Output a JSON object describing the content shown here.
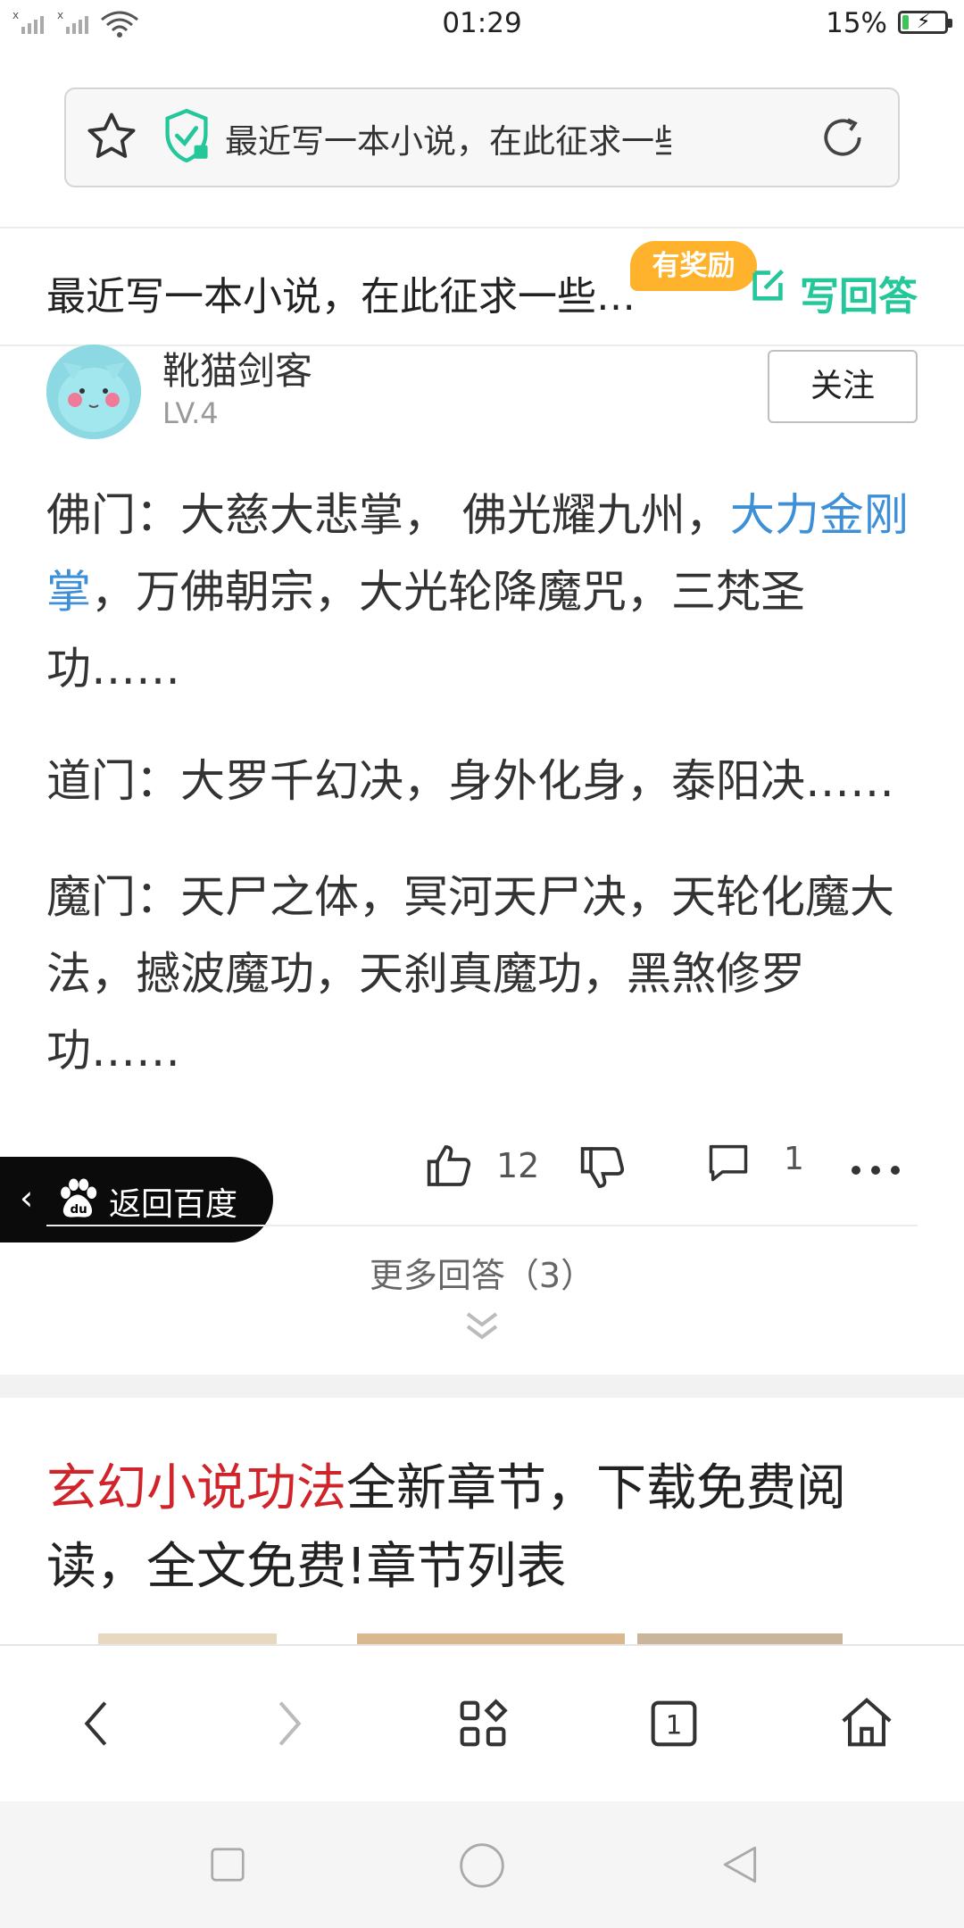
{
  "status_bar": {
    "time": "01:29",
    "battery_percent": "15%",
    "battery_level": 0.15,
    "icons": [
      "signal-icon",
      "signal-icon",
      "wifi-icon",
      "battery-charging-icon"
    ]
  },
  "address_bar": {
    "url_text": "最近写一本小说，在此征求一些…",
    "icons": [
      "star-icon",
      "shield-check-icon",
      "refresh-icon"
    ]
  },
  "question": {
    "title": "最近写一本小说，在此征求一些…",
    "reward_badge": "有奖励",
    "write_answer": "写回答"
  },
  "answer": {
    "user": {
      "name": "靴猫剑客",
      "level": "LV.4"
    },
    "follow_label": "关注",
    "paragraphs": {
      "p1_a": "佛门：大慈大悲掌， 佛光耀九州，",
      "p1_link": "大力金刚掌",
      "p1_b": "，万佛朝宗，大光轮降魔咒，三梵圣功……",
      "p2": "道门：大罗千幻决，身外化身，泰阳决……",
      "p3": "魔门：天尸之体，冥河天尸决，天轮化魔大法，撼波魔功，天刹真魔功，黑煞修罗功……"
    },
    "likes": "12",
    "comments": "1",
    "more": "..."
  },
  "baidu_pill": {
    "chevron": "‹",
    "label": "返回百度"
  },
  "more_answers": "更多回答（3）",
  "ad": {
    "highlight": "玄幻小说功法",
    "rest": "全新章节，下载免费阅读，全文免费!章节列表"
  },
  "toolbar": {
    "items": [
      "back-icon",
      "forward-icon",
      "menu-grid-icon",
      "tabs-icon",
      "home-icon"
    ],
    "tab_count": "1"
  },
  "system_nav": [
    "square-icon",
    "circle-icon",
    "triangle-back-icon"
  ],
  "colors": {
    "accent_green": "#24c79a",
    "reward_orange": "#ffb22b",
    "link_blue": "#3d8fd8",
    "ad_red": "#d1232a"
  }
}
